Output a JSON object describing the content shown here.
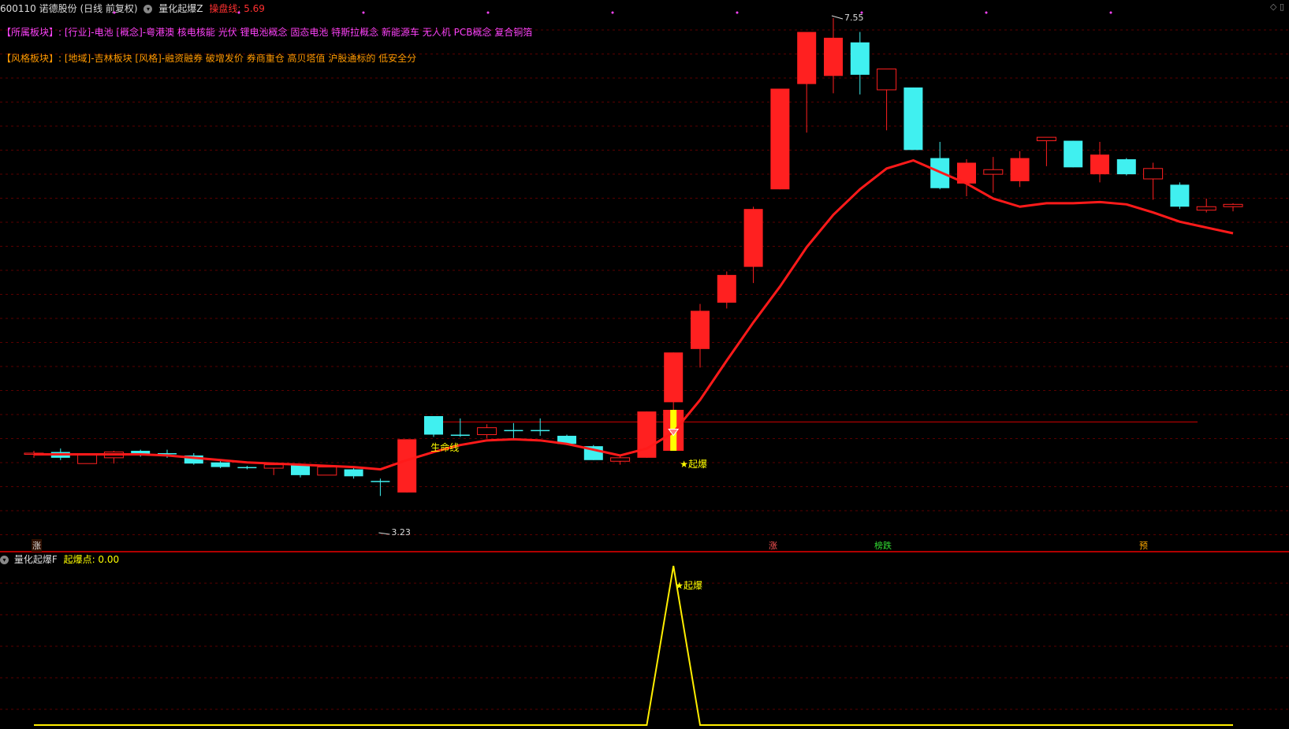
{
  "header": {
    "stock": "600110 诺德股份 (日线 前复权)",
    "indicator_name": "量化起爆Z",
    "ref_line": "操盘线: 5.69",
    "colors": {
      "stock": "#dddddd",
      "indicator": "#dddddd",
      "ref": "#ff3030"
    }
  },
  "corner_icons": [
    "◇",
    "▯"
  ],
  "sector": {
    "label": "【所属板块】:",
    "content": "[行业]-电池 [概念]-粤港澳 核电核能 光伏 锂电池概念 固态电池 特斯拉概念 新能源车 无人机 PCB概念 复合铜箔"
  },
  "style": {
    "label": "【风格板块】:",
    "content": "[地域]-吉林板块 [风格]-融资融券 破增发价 券商重仓 高贝塔值 沪股通标的 低安全分"
  },
  "annotations": {
    "high": "7.55",
    "low": "3.23",
    "lifeline": "生命线",
    "burst": "★起爆"
  },
  "bottom_tags": [
    {
      "text": "涨",
      "color": "#ff5555"
    },
    {
      "text": "榜跌",
      "color": "#33dd33"
    },
    {
      "text": "涨",
      "color": "#ff5555"
    },
    {
      "text": "预",
      "color": "#ffaa00"
    }
  ],
  "sub": {
    "indicator_name": "量化起爆F",
    "value": "起爆点: 0.00",
    "burst": "★起爆"
  },
  "chart_data": {
    "type": "candlestick",
    "ylim": [
      3.2,
      7.6
    ],
    "candles": [
      {
        "o": 3.82,
        "h": 3.84,
        "l": 3.78,
        "c": 3.82,
        "up": true
      },
      {
        "o": 3.83,
        "h": 3.86,
        "l": 3.76,
        "c": 3.78,
        "up": false
      },
      {
        "o": 3.81,
        "h": 3.82,
        "l": 3.73,
        "c": 3.73,
        "up": true
      },
      {
        "o": 3.78,
        "h": 3.84,
        "l": 3.73,
        "c": 3.83,
        "up": true
      },
      {
        "o": 3.84,
        "h": 3.85,
        "l": 3.79,
        "c": 3.81,
        "up": false
      },
      {
        "o": 3.82,
        "h": 3.85,
        "l": 3.78,
        "c": 3.81,
        "up": false
      },
      {
        "o": 3.8,
        "h": 3.82,
        "l": 3.72,
        "c": 3.73,
        "up": false
      },
      {
        "o": 3.74,
        "h": 3.76,
        "l": 3.69,
        "c": 3.7,
        "up": false
      },
      {
        "o": 3.7,
        "h": 3.71,
        "l": 3.68,
        "c": 3.69,
        "up": false
      },
      {
        "o": 3.69,
        "h": 3.74,
        "l": 3.63,
        "c": 3.72,
        "up": true
      },
      {
        "o": 3.72,
        "h": 3.73,
        "l": 3.61,
        "c": 3.63,
        "up": false
      },
      {
        "o": 3.63,
        "h": 3.7,
        "l": 3.63,
        "c": 3.7,
        "up": true
      },
      {
        "o": 3.68,
        "h": 3.69,
        "l": 3.6,
        "c": 3.62,
        "up": false
      },
      {
        "o": 3.57,
        "h": 3.6,
        "l": 3.45,
        "c": 3.58,
        "up": false
      },
      {
        "o": 3.48,
        "h": 3.94,
        "l": 3.48,
        "c": 3.94,
        "up": true
      },
      {
        "o": 4.14,
        "h": 4.14,
        "l": 3.96,
        "c": 3.98,
        "up": false
      },
      {
        "o": 3.98,
        "h": 4.12,
        "l": 3.96,
        "c": 3.97,
        "up": false
      },
      {
        "o": 3.98,
        "h": 4.07,
        "l": 3.95,
        "c": 4.04,
        "up": true
      },
      {
        "o": 4.02,
        "h": 4.08,
        "l": 3.95,
        "c": 4.02,
        "up": false
      },
      {
        "o": 4.02,
        "h": 4.12,
        "l": 3.97,
        "c": 4.01,
        "up": false
      },
      {
        "o": 3.97,
        "h": 3.98,
        "l": 3.89,
        "c": 3.9,
        "up": false
      },
      {
        "o": 3.88,
        "h": 3.89,
        "l": 3.76,
        "c": 3.76,
        "up": false
      },
      {
        "o": 3.75,
        "h": 3.8,
        "l": 3.72,
        "c": 3.78,
        "up": true
      },
      {
        "o": 3.78,
        "h": 4.18,
        "l": 3.78,
        "c": 4.18,
        "up": true
      },
      {
        "o": 4.26,
        "h": 4.69,
        "l": 4.17,
        "c": 4.69,
        "up": true
      },
      {
        "o": 4.72,
        "h": 5.11,
        "l": 4.56,
        "c": 5.05,
        "up": true
      },
      {
        "o": 5.12,
        "h": 5.39,
        "l": 5.07,
        "c": 5.36,
        "up": true
      },
      {
        "o": 5.43,
        "h": 5.95,
        "l": 5.29,
        "c": 5.93,
        "up": true
      },
      {
        "o": 6.1,
        "h": 6.97,
        "l": 6.1,
        "c": 6.97,
        "up": true
      },
      {
        "o": 7.01,
        "h": 7.26,
        "l": 6.59,
        "c": 7.46,
        "up": true
      },
      {
        "o": 7.08,
        "h": 7.58,
        "l": 6.93,
        "c": 7.41,
        "up": true
      },
      {
        "o": 7.37,
        "h": 7.46,
        "l": 6.92,
        "c": 7.09,
        "up": false
      },
      {
        "o": 7.14,
        "h": 7.14,
        "l": 6.61,
        "c": 6.96,
        "up": true
      },
      {
        "o": 6.98,
        "h": 6.98,
        "l": 6.44,
        "c": 6.44,
        "up": false
      },
      {
        "o": 6.37,
        "h": 6.51,
        "l": 6.1,
        "c": 6.11,
        "up": false
      },
      {
        "o": 6.15,
        "h": 6.36,
        "l": 6.04,
        "c": 6.33,
        "up": true
      },
      {
        "o": 6.23,
        "h": 6.38,
        "l": 6.07,
        "c": 6.27,
        "up": true
      },
      {
        "o": 6.17,
        "h": 6.43,
        "l": 6.12,
        "c": 6.37,
        "up": true
      },
      {
        "o": 6.52,
        "h": 6.52,
        "l": 6.3,
        "c": 6.55,
        "up": true
      },
      {
        "o": 6.52,
        "h": 6.52,
        "l": 6.29,
        "c": 6.29,
        "up": false
      },
      {
        "o": 6.23,
        "h": 6.51,
        "l": 6.16,
        "c": 6.4,
        "up": true
      },
      {
        "o": 6.36,
        "h": 6.37,
        "l": 6.22,
        "c": 6.23,
        "up": false
      },
      {
        "o": 6.19,
        "h": 6.33,
        "l": 6.01,
        "c": 6.28,
        "up": true
      },
      {
        "o": 6.14,
        "h": 6.16,
        "l": 5.93,
        "c": 5.95,
        "up": false
      },
      {
        "o": 5.95,
        "h": 6.02,
        "l": 5.9,
        "c": 5.92,
        "up": true
      },
      {
        "o": 5.97,
        "h": 5.98,
        "l": 5.91,
        "c": 5.95,
        "up": true
      }
    ],
    "ma": [
      3.81,
      3.81,
      3.81,
      3.81,
      3.81,
      3.8,
      3.78,
      3.76,
      3.74,
      3.73,
      3.72,
      3.71,
      3.7,
      3.68,
      3.76,
      3.83,
      3.89,
      3.93,
      3.94,
      3.93,
      3.9,
      3.85,
      3.8,
      3.86,
      4.0,
      4.28,
      4.62,
      4.95,
      5.26,
      5.6,
      5.88,
      6.1,
      6.28,
      6.35,
      6.25,
      6.15,
      6.02,
      5.95,
      5.98,
      5.98,
      5.99,
      5.97,
      5.9,
      5.82,
      5.77,
      5.72
    ],
    "lifeline": 4.09,
    "burst_index": 24,
    "burst_signal": [
      0,
      0,
      0,
      0,
      0,
      0,
      0,
      0,
      0,
      0,
      0,
      0,
      0,
      0,
      0,
      0,
      0,
      0,
      0,
      0,
      0,
      0,
      0,
      0,
      1,
      0,
      0,
      0,
      0,
      0,
      0,
      0,
      0,
      0,
      0,
      0,
      0,
      0,
      0,
      0,
      0,
      0,
      0,
      0,
      0,
      0
    ]
  }
}
